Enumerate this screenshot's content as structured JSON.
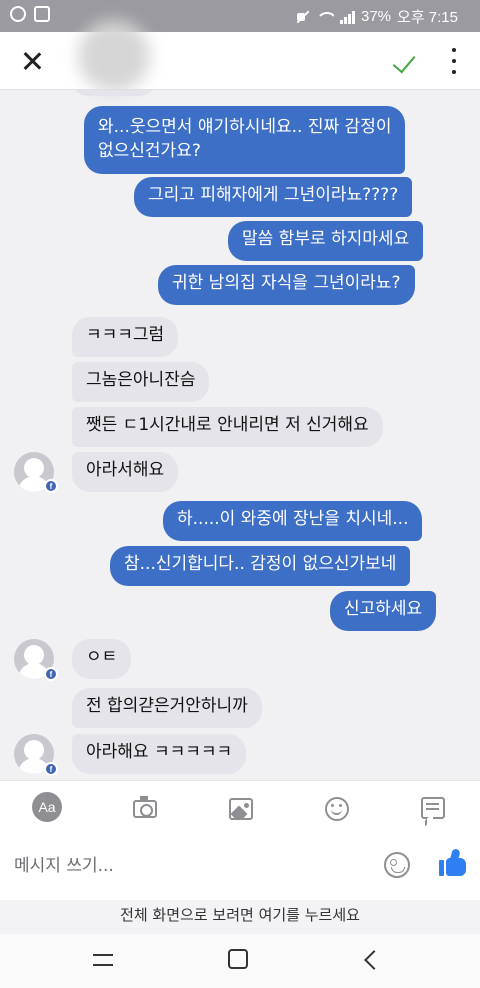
{
  "status_bar": {
    "battery": "37%",
    "time": "오후 7:15"
  },
  "header": {
    "close_icon": "close-icon",
    "done_icon": "check-icon",
    "more_icon": "more-vertical-icon",
    "done_color": "#44a640"
  },
  "colors": {
    "outgoing_bubble": "#3d6fc6",
    "incoming_bubble": "#e4e4ea",
    "like_blue": "#2d7ff2"
  },
  "messages": [
    {
      "dir": "out",
      "lines": [
        "와...웃으면서 얘기하시네요.. 진짜 감정이",
        "없으신건가요?"
      ]
    },
    {
      "dir": "out",
      "text": "그리고 피해자에게 그년이라뇨????"
    },
    {
      "dir": "out",
      "text": "말씀 함부로 하지마세요"
    },
    {
      "dir": "out",
      "text": "귀한 남의집 자식을 그년이라뇨?"
    },
    {
      "dir": "in",
      "text": "ㅋㅋㅋ그럼"
    },
    {
      "dir": "in",
      "text": "그놈은아니잔슴"
    },
    {
      "dir": "in",
      "text": "쨋든 ㄷ1시간내로 안내리면 저 신거해요"
    },
    {
      "dir": "in",
      "text": "아라서해요"
    },
    {
      "dir": "out",
      "text": "하.....이 와중에 장난을 치시네..."
    },
    {
      "dir": "out",
      "text": "참...신기합니다.. 감정이 없으신가보네"
    },
    {
      "dir": "out",
      "text": "신고하세요"
    },
    {
      "dir": "in",
      "text": "ㅇㅌ"
    },
    {
      "dir": "in",
      "text": "전 합의갿은거안하니까"
    },
    {
      "dir": "in",
      "text": "아라해요 ㅋㅋㅋㅋㅋ"
    }
  ],
  "composer": {
    "tools": [
      "text-format-icon",
      "camera-icon",
      "image-icon",
      "emoji-icon",
      "note-icon"
    ],
    "aa_label": "Aa",
    "placeholder": "메시지 쓰기...",
    "sticker_icon": "sticker-icon",
    "like_icon": "thumbs-up-icon"
  },
  "fullscreen_hint": "전체 화면으로 보려면 여기를 누르세요",
  "nav": [
    "recent-apps-icon",
    "home-icon",
    "back-icon"
  ]
}
